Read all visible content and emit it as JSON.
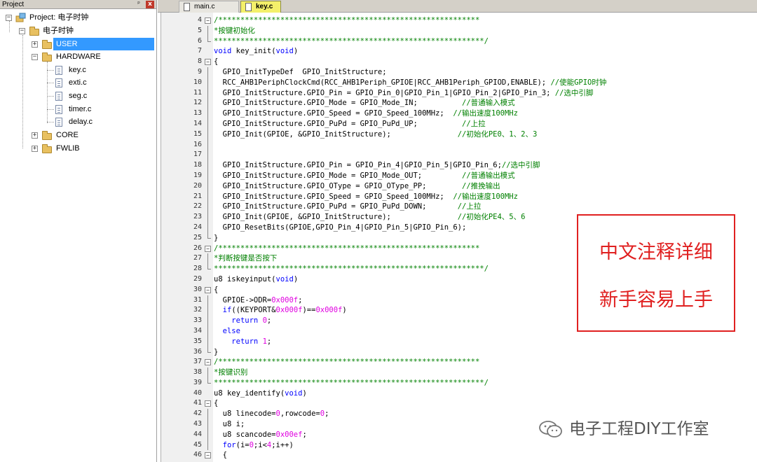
{
  "project_panel": {
    "title": "Project",
    "pin_glyph": "ᵖ",
    "close_glyph": "x",
    "tree": {
      "root": "Project: 电子时钟",
      "target": "电子时钟",
      "groups": {
        "user": "USER",
        "hardware": "HARDWARE",
        "core": "CORE",
        "fwlib": "FWLIB"
      },
      "hardware_files": [
        "key.c",
        "exti.c",
        "seg.c",
        "timer.c",
        "delay.c"
      ],
      "expand_glyph": "+",
      "collapse_glyph": "−"
    }
  },
  "tabs": [
    {
      "label": "main.c",
      "active": false
    },
    {
      "label": "key.c",
      "active": true
    }
  ],
  "editor": {
    "lines": [
      {
        "n": "4",
        "t": "/***********************************************************",
        "cls": "c-cmt",
        "fold": "open"
      },
      {
        "n": "5",
        "t": "*按键初始化",
        "cls": "c-cmt",
        "fold": "line"
      },
      {
        "n": "6",
        "t": "*************************************************************/",
        "cls": "c-cmt",
        "fold": "end"
      },
      {
        "n": "7",
        "t": "void key_init(void)",
        "cls": "",
        "fold": ""
      },
      {
        "n": "8",
        "t": "{",
        "cls": "",
        "fold": "open"
      },
      {
        "n": "9",
        "t": "  GPIO_InitTypeDef  GPIO_InitStructure;",
        "cls": "",
        "fold": "line"
      },
      {
        "n": "10",
        "t": "  RCC_AHB1PeriphClockCmd(RCC_AHB1Periph_GPIOE|RCC_AHB1Periph_GPIOD,ENABLE); //使能GPIO时钟",
        "cls": "",
        "fold": "line"
      },
      {
        "n": "11",
        "t": "  GPIO_InitStructure.GPIO_Pin = GPIO_Pin_0|GPIO_Pin_1|GPIO_Pin_2|GPIO_Pin_3; //选中引脚",
        "cls": "",
        "fold": "line"
      },
      {
        "n": "12",
        "t": "  GPIO_InitStructure.GPIO_Mode = GPIO_Mode_IN;          //普通输入模式",
        "cls": "",
        "fold": "line"
      },
      {
        "n": "13",
        "t": "  GPIO_InitStructure.GPIO_Speed = GPIO_Speed_100MHz;  //输出速度100MHz",
        "cls": "",
        "fold": "line"
      },
      {
        "n": "14",
        "t": "  GPIO_InitStructure.GPIO_PuPd = GPIO_PuPd_UP;          //上拉",
        "cls": "",
        "fold": "line"
      },
      {
        "n": "15",
        "t": "  GPIO_Init(GPIOE, &GPIO_InitStructure);               //初始化PE0、1、2、3",
        "cls": "",
        "fold": "line"
      },
      {
        "n": "16",
        "t": "",
        "cls": "",
        "fold": "line"
      },
      {
        "n": "17",
        "t": "",
        "cls": "",
        "fold": "line"
      },
      {
        "n": "18",
        "t": "  GPIO_InitStructure.GPIO_Pin = GPIO_Pin_4|GPIO_Pin_5|GPIO_Pin_6;//选中引脚",
        "cls": "",
        "fold": "line"
      },
      {
        "n": "19",
        "t": "  GPIO_InitStructure.GPIO_Mode = GPIO_Mode_OUT;         //普通输出模式",
        "cls": "",
        "fold": "line"
      },
      {
        "n": "20",
        "t": "  GPIO_InitStructure.GPIO_OType = GPIO_OType_PP;        //推挽输出",
        "cls": "",
        "fold": "line"
      },
      {
        "n": "21",
        "t": "  GPIO_InitStructure.GPIO_Speed = GPIO_Speed_100MHz;  //输出速度100MHz",
        "cls": "",
        "fold": "line"
      },
      {
        "n": "22",
        "t": "  GPIO_InitStructure.GPIO_PuPd = GPIO_PuPd_DOWN;       //上拉",
        "cls": "",
        "fold": "line"
      },
      {
        "n": "23",
        "t": "  GPIO_Init(GPIOE, &GPIO_InitStructure);               //初始化PE4、5、6",
        "cls": "",
        "fold": "line"
      },
      {
        "n": "24",
        "t": "  GPIO_ResetBits(GPIOE,GPIO_Pin_4|GPIO_Pin_5|GPIO_Pin_6);",
        "cls": "",
        "fold": "line"
      },
      {
        "n": "25",
        "t": "}",
        "cls": "",
        "fold": "end"
      },
      {
        "n": "26",
        "t": "/***********************************************************",
        "cls": "c-cmt",
        "fold": "open"
      },
      {
        "n": "27",
        "t": "*判断按键是否按下",
        "cls": "c-cmt",
        "fold": "line"
      },
      {
        "n": "28",
        "t": "*************************************************************/",
        "cls": "c-cmt",
        "fold": "end"
      },
      {
        "n": "29",
        "t": "u8 iskeyinput(void)",
        "cls": "",
        "fold": ""
      },
      {
        "n": "30",
        "t": "{",
        "cls": "",
        "fold": "open"
      },
      {
        "n": "31",
        "t": "  GPIOE->ODR=0x000f;",
        "cls": "",
        "fold": "line"
      },
      {
        "n": "32",
        "t": "  if((KEYPORT&0x000f)==0x000f)",
        "cls": "",
        "fold": "line"
      },
      {
        "n": "33",
        "t": "    return 0;",
        "cls": "",
        "fold": "line"
      },
      {
        "n": "34",
        "t": "  else",
        "cls": "",
        "fold": "line"
      },
      {
        "n": "35",
        "t": "    return 1;",
        "cls": "",
        "fold": "line"
      },
      {
        "n": "36",
        "t": "}",
        "cls": "",
        "fold": "end"
      },
      {
        "n": "37",
        "t": "/***********************************************************",
        "cls": "c-cmt",
        "fold": "open"
      },
      {
        "n": "38",
        "t": "*按键识别",
        "cls": "c-cmt",
        "fold": "line"
      },
      {
        "n": "39",
        "t": "*************************************************************/",
        "cls": "c-cmt",
        "fold": "end"
      },
      {
        "n": "40",
        "t": "u8 key_identify(void)",
        "cls": "",
        "fold": ""
      },
      {
        "n": "41",
        "t": "{",
        "cls": "",
        "fold": "open"
      },
      {
        "n": "42",
        "t": "  u8 linecode=0,rowcode=0;",
        "cls": "",
        "fold": "line"
      },
      {
        "n": "43",
        "t": "  u8 i;",
        "cls": "",
        "fold": "line"
      },
      {
        "n": "44",
        "t": "  u8 scancode=0x00ef;",
        "cls": "",
        "fold": "line"
      },
      {
        "n": "45",
        "t": "  for(i=0;i<4;i++)",
        "cls": "",
        "fold": "line"
      },
      {
        "n": "46",
        "t": "  {",
        "cls": "",
        "fold": "open"
      }
    ]
  },
  "annotation": {
    "line1": "中文注释详细",
    "line2": "新手容易上手",
    "color": "#e02020"
  },
  "watermark": {
    "text": "电子工程DIY工作室",
    "icon": "wechat-icon"
  }
}
